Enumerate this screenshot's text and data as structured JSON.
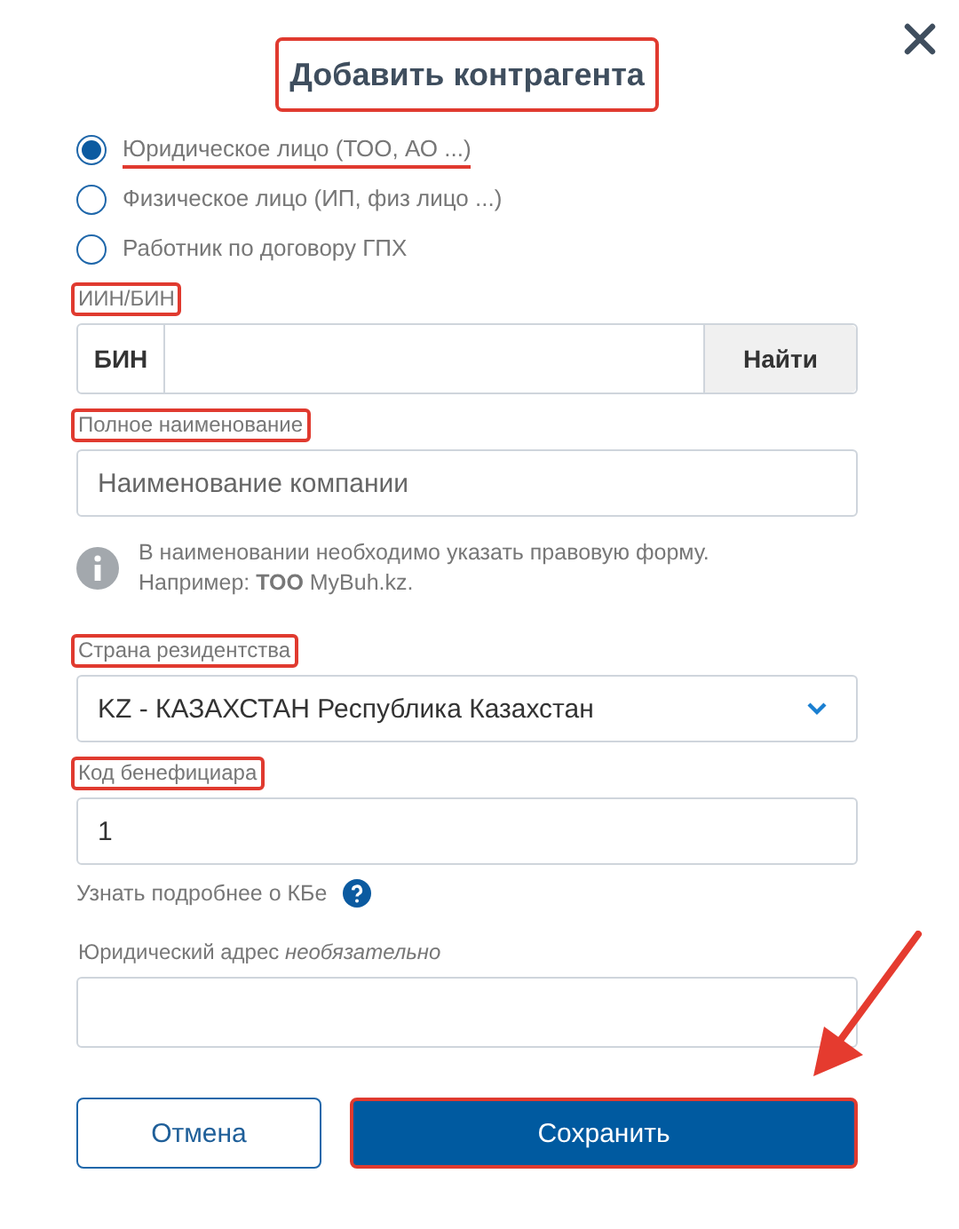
{
  "dialog": {
    "title": "Добавить контрагента",
    "title_highlighted": true
  },
  "entity_types": [
    {
      "label": "Юридическое лицо (ТОО, АО ...)",
      "selected": true,
      "underlined": true
    },
    {
      "label": "Физическое лицо (ИП, физ лицо ...)",
      "selected": false,
      "underlined": false
    },
    {
      "label": "Работник по договору ГПХ",
      "selected": false,
      "underlined": false
    }
  ],
  "fields": [
    {
      "kind": "prefixed",
      "label": "ИИН/БИН",
      "highlighted": true,
      "prefix": "БИН",
      "button": "Найти"
    },
    {
      "kind": "text",
      "label": "Полное наименование",
      "highlighted": true,
      "placeholder": "Наименование компании",
      "note": "В наименовании необходимо указать правовую форму. Например: **ТОО** MyBuh.kz."
    },
    {
      "kind": "select",
      "label": "Страна резидентства",
      "highlighted": true,
      "value": "KZ - КАЗАХСТАН Республика Казахстан"
    },
    {
      "kind": "text",
      "label": "Код бенефициара",
      "highlighted": true,
      "value": "1",
      "help_link": "Узнать подробнее о КБе"
    },
    {
      "kind": "text",
      "label": "Юридический адрес *необязательно*",
      "highlighted": false
    }
  ],
  "buttons": [
    {
      "label": "Отмена",
      "kind": "secondary",
      "highlighted": false,
      "pointer_arrow": false
    },
    {
      "label": "Сохранить",
      "kind": "primary",
      "highlighted": true,
      "pointer_arrow": true
    }
  ]
}
